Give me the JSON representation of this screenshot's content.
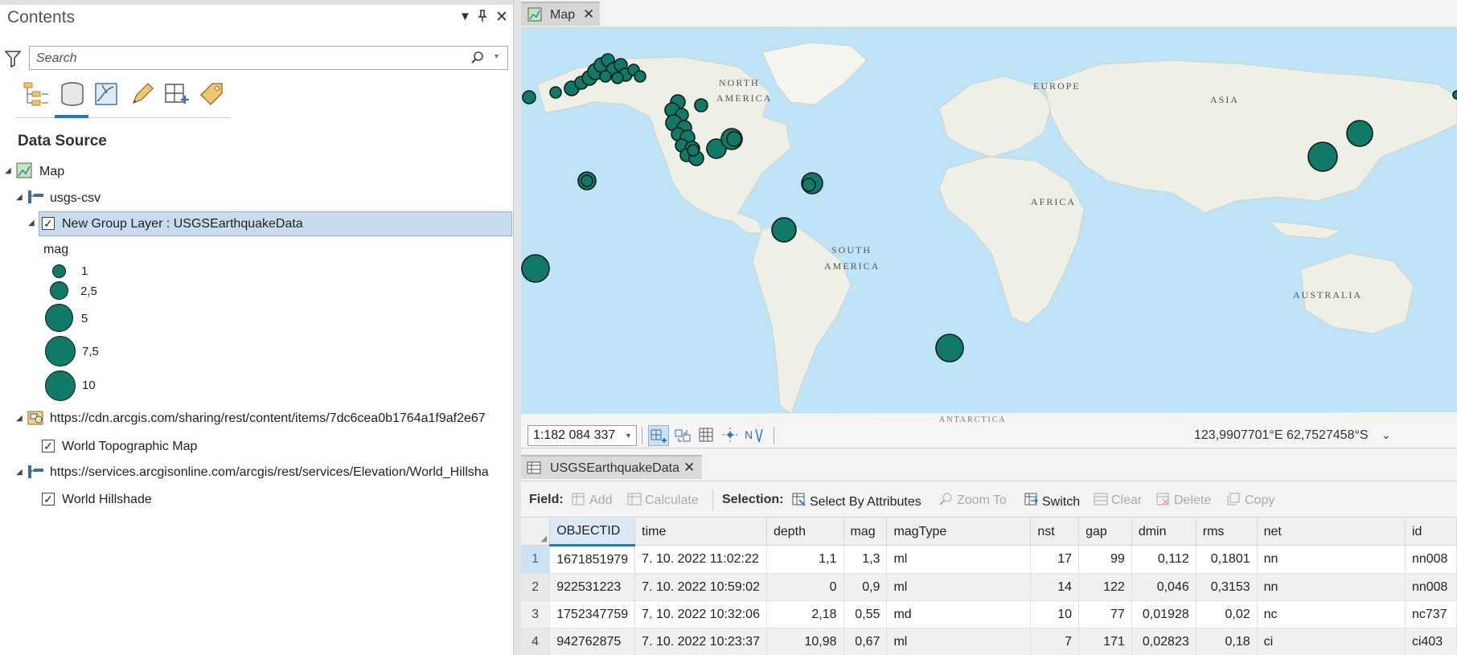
{
  "contents": {
    "title": "Contents",
    "search_placeholder": "Search",
    "heading": "Data Source",
    "tree": {
      "map": "Map",
      "usgs_csv": "usgs-csv",
      "group_layer": "New Group Layer : USGSEarthquakeData",
      "legend_field": "mag",
      "legend": [
        {
          "label": "1"
        },
        {
          "label": "2,5"
        },
        {
          "label": "5"
        },
        {
          "label": "7,5"
        },
        {
          "label": "10"
        }
      ],
      "topo_source": "https://cdn.arcgis.com/sharing/rest/content/items/7dc6cea0b1764a1f9af2e67",
      "topo_layer": "World Topographic Map",
      "hillshade_source": "https://services.arcgisonline.com/arcgis/rest/services/Elevation/World_Hillsha",
      "hillshade_layer": "World Hillshade"
    },
    "icons": [
      "list-by-drawing-order-icon",
      "list-by-data-source-icon",
      "list-by-selection-icon",
      "list-by-editing-icon",
      "list-by-snapping-icon",
      "list-by-labeling-icon"
    ]
  },
  "map": {
    "tab_label": "Map",
    "labels": {
      "north_america_1": "NORTH",
      "north_america_2": "AMERICA",
      "europe": "EUROPE",
      "asia": "ASIA",
      "africa": "AFRICA",
      "south_america_1": "SOUTH",
      "south_america_2": "AMERICA",
      "australia": "AUSTRALIA",
      "antarctica": "ANTARCTICA"
    },
    "colors": {
      "ocean": "#bfe3f7",
      "land": "#eef0e6",
      "point_fill": "#107a68",
      "point_stroke": "#0a1a17"
    },
    "scale": "1:182 084 337",
    "coordinates": "123,9907701°E 62,7527458°S"
  },
  "table": {
    "tab_label": "USGSEarthquakeData",
    "toolbar": {
      "field_label": "Field:",
      "add": "Add",
      "calculate": "Calculate",
      "selection_label": "Selection:",
      "select_by_attributes": "Select By Attributes",
      "zoom_to": "Zoom To",
      "switch": "Switch",
      "clear": "Clear",
      "delete": "Delete",
      "copy": "Copy"
    },
    "columns": [
      "OBJECTID",
      "time",
      "depth",
      "mag",
      "magType",
      "nst",
      "gap",
      "dmin",
      "rms",
      "net",
      "id"
    ],
    "rows": [
      [
        "1",
        "1671851979",
        "7. 10. 2022 11:02:22",
        "1,1",
        "1,3",
        "ml",
        "17",
        "99",
        "0,112",
        "0,1801",
        "nn",
        "nn008"
      ],
      [
        "2",
        "922531223",
        "7. 10. 2022 10:59:02",
        "0",
        "0,9",
        "ml",
        "14",
        "122",
        "0,046",
        "0,3153",
        "nn",
        "nn008"
      ],
      [
        "3",
        "1752347759",
        "7. 10. 2022 10:32:06",
        "2,18",
        "0,55",
        "md",
        "10",
        "77",
        "0,01928",
        "0,02",
        "nc",
        "nc737"
      ],
      [
        "4",
        "942762875",
        "7. 10. 2022 10:23:37",
        "10,98",
        "0,67",
        "ml",
        "7",
        "171",
        "0,02823",
        "0,18",
        "ci",
        "ci403"
      ]
    ]
  }
}
